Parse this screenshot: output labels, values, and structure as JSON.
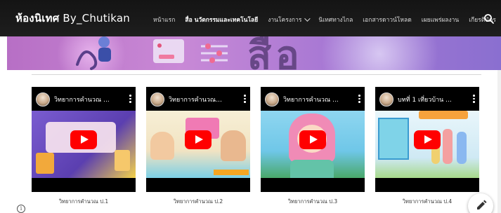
{
  "header": {
    "site_title_bold": "ห้องนิเทศ",
    "site_title_rest": "By_Chutikan",
    "nav": [
      {
        "label": "หน้าแรก",
        "active": false,
        "dropdown": false
      },
      {
        "label": "สื่อ นวัตกรรมและเทคโนโลยี",
        "active": true,
        "dropdown": false
      },
      {
        "label": "งานโครงการ",
        "active": false,
        "dropdown": true
      },
      {
        "label": "นิเทศทางไกล",
        "active": false,
        "dropdown": false
      },
      {
        "label": "เอกสารดาวน์โหลด",
        "active": false,
        "dropdown": false
      },
      {
        "label": "เผยแพร่ผลงาน",
        "active": false,
        "dropdown": false
      },
      {
        "label": "เกียรติบัตร",
        "active": false,
        "dropdown": false
      }
    ],
    "search_icon": "search-icon"
  },
  "videos": [
    {
      "title": "วิทยาการคำนวณ ...",
      "caption": "วิทยาการคำนวณ ป.1",
      "thumb_color": "#6b4fb8"
    },
    {
      "title": "วิทยาการคำนวณ...",
      "caption": "วิทยาการคำนวณ ป.2",
      "thumb_color": "#f3e8c8"
    },
    {
      "title": "วิทยาการคำนวณ ...",
      "caption": "วิทยาการคำนวณ ป.3",
      "thumb_color": "#6fc7e8"
    },
    {
      "title": "บทที่ 1 เที่ยวบ้าน ...",
      "caption": "วิทยาการคำนวณ ป.4",
      "thumb_color": "#cfe9f4"
    }
  ],
  "colors": {
    "header_bg": "#1a1a1a",
    "banner_purple": "#b878c8",
    "play_red": "#ff0000"
  },
  "floating": {
    "info_icon": "info-icon",
    "edit_icon": "pencil-icon"
  }
}
